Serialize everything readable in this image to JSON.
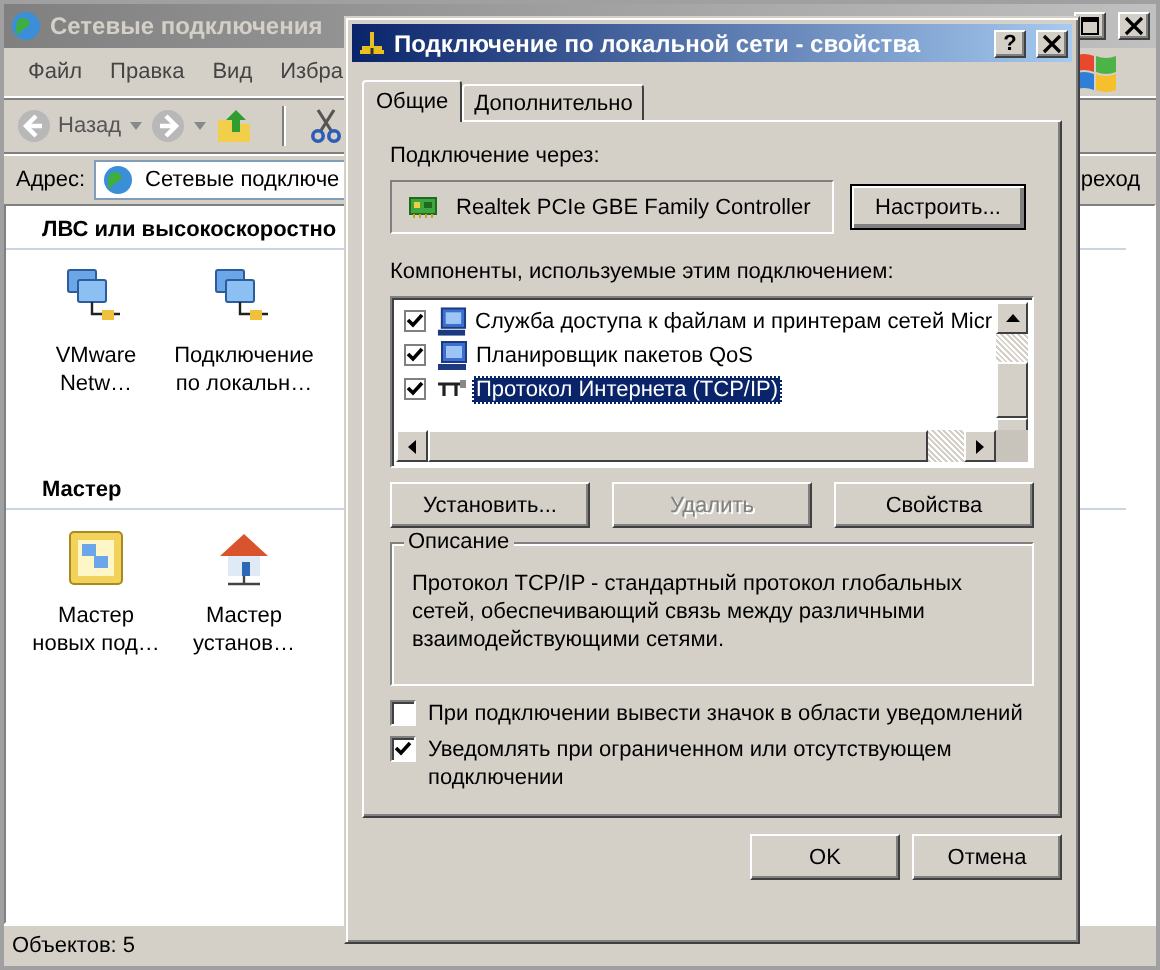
{
  "explorer": {
    "title": "Сетевые подключения",
    "menu": [
      "Файл",
      "Правка",
      "Вид",
      "Избра"
    ],
    "toolbar": {
      "back": "Назад"
    },
    "address": {
      "label": "Адрес:",
      "value": "Сетевые подключе",
      "go_button": "реход"
    },
    "groups": [
      {
        "title": "ЛВС или высокоскоростно",
        "items": [
          {
            "kind": "network",
            "lines": [
              "VMware",
              "Netw…"
            ]
          },
          {
            "kind": "network",
            "lines": [
              "Подключение",
              "по локальн…"
            ]
          }
        ]
      },
      {
        "title": "Мастер",
        "items": [
          {
            "kind": "wizard",
            "lines": [
              "Мастер",
              "новых под…"
            ]
          },
          {
            "kind": "home",
            "lines": [
              "Мастер",
              "установ…"
            ]
          }
        ]
      }
    ],
    "status_bar": "Объектов: 5"
  },
  "dialog": {
    "title": "Подключение по локальной сети - свойства",
    "help_button": "?",
    "tabs": [
      {
        "label": "Общие",
        "selected": true
      },
      {
        "label": "Дополнительно",
        "selected": false
      }
    ],
    "connect_using": {
      "label": "Подключение через:",
      "adapter": "Realtek PCIe GBE Family Controller",
      "button": "Настроить..."
    },
    "components": {
      "label": "Компоненты, используемые этим подключением:",
      "items": [
        {
          "kind": "service",
          "label": "Служба доступа к файлам и принтерам сетей Micr",
          "checked": true,
          "selected": false
        },
        {
          "kind": "service",
          "label": "Планировщик пакетов QoS",
          "checked": true,
          "selected": false
        },
        {
          "kind": "protocol",
          "label": "Протокол Интернета (TCP/IP)",
          "checked": true,
          "selected": true
        }
      ]
    },
    "buttons": [
      {
        "label": "Установить...",
        "disabled": false
      },
      {
        "label": "Удалить",
        "disabled": true
      },
      {
        "label": "Свойства",
        "disabled": false
      }
    ],
    "description": {
      "title": "Описание",
      "text": "Протокол TCP/IP - стандартный протокол глобальных сетей, обеспечивающий связь между различными взаимодействующими сетями."
    },
    "options": [
      {
        "label": "При подключении вывести значок в области уведомлений",
        "checked": false
      },
      {
        "label": "Уведомлять при ограниченном или отсутствующем подключении",
        "checked": true
      }
    ],
    "footer_buttons": [
      "OK",
      "Отмена"
    ]
  }
}
